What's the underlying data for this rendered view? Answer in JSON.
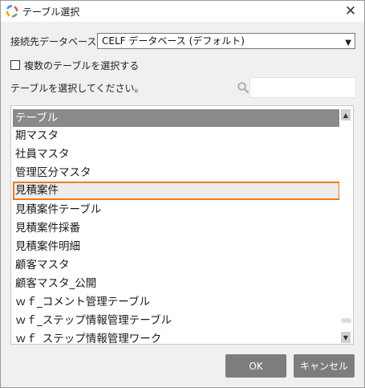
{
  "window": {
    "title": "テーブル選択",
    "app_icon": "app-logo-icon",
    "close_label": "✕"
  },
  "database": {
    "label": "接続先データベース",
    "selected": "CELF データベース (デフォルト)"
  },
  "multi_select": {
    "label": "複数のテーブルを選択する",
    "checked": false
  },
  "search": {
    "label": "テーブルを選択してください。",
    "value": "",
    "placeholder": ""
  },
  "table_list": {
    "header": "テーブル",
    "items": [
      "期マスタ",
      "社員マスタ",
      "管理区分マスタ",
      "見積案件",
      "見積案件テーブル",
      "見積案件採番",
      "見積案件明細",
      "顧客マスタ",
      "顧客マスタ_公開",
      "ｗｆ_コメント管理テーブル",
      "ｗｆ_ステップ情報管理テーブル",
      "ｗｆ_ステップ情報管理ワーク"
    ],
    "selected_index": 3
  },
  "buttons": {
    "ok": "OK",
    "cancel": "キャンセル"
  },
  "colors": {
    "selection_border": "#f07a1c",
    "button_bg": "#7d7d7d",
    "header_bg": "#8a8a8a"
  }
}
